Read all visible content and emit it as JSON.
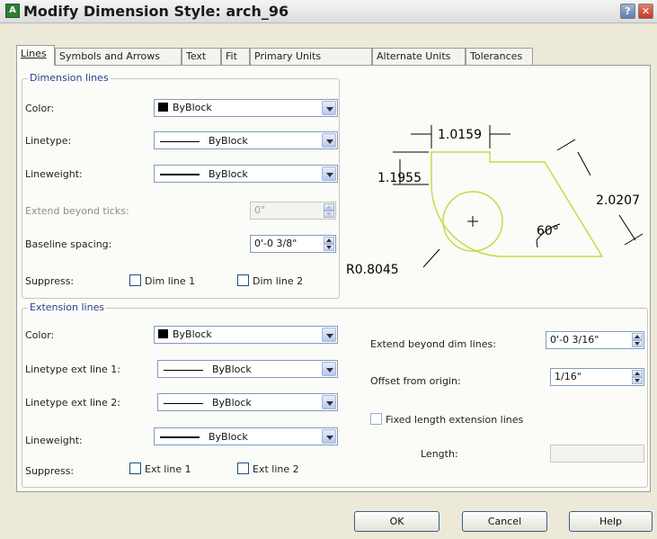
{
  "window": {
    "title": "Modify Dimension Style: arch_96",
    "help_symbol": "?",
    "close_symbol": "✕"
  },
  "tabs": [
    "Lines",
    "Symbols and Arrows",
    "Text",
    "Fit",
    "Primary Units",
    "Alternate Units",
    "Tolerances"
  ],
  "dimension_lines": {
    "group_title": "Dimension lines",
    "color_label": "Color:",
    "color_value": "ByBlock",
    "linetype_label": "Linetype:",
    "linetype_value": "ByBlock",
    "lineweight_label": "Lineweight:",
    "lineweight_value": "ByBlock",
    "extend_label": "Extend beyond ticks:",
    "extend_value": "0\"",
    "baseline_label": "Baseline spacing:",
    "baseline_value": "0'-0 3/8\"",
    "suppress_label": "Suppress:",
    "dim_line_1": "Dim line 1",
    "dim_line_2": "Dim line 2"
  },
  "extension_lines": {
    "group_title": "Extension lines",
    "color_label": "Color:",
    "color_value": "ByBlock",
    "linetype1_label": "Linetype ext line 1:",
    "linetype1_value": "ByBlock",
    "linetype2_label": "Linetype ext line 2:",
    "linetype2_value": "ByBlock",
    "lineweight_label": "Lineweight:",
    "lineweight_value": "ByBlock",
    "suppress_label": "Suppress:",
    "ext_line_1": "Ext line 1",
    "ext_line_2": "Ext line 2",
    "extend_label": "Extend beyond dim lines:",
    "extend_value": "0'-0 3/16\"",
    "offset_label": "Offset from origin:",
    "offset_value": "1/16\"",
    "fixed_label": "Fixed length extension lines",
    "length_label": "Length:",
    "length_value": ""
  },
  "preview": {
    "dim_top": "1.0159",
    "dim_left": "1.1955",
    "dim_right": "2.0207",
    "angle": "60°",
    "radius": "R0.8045",
    "shape_color": "#c9d84a"
  },
  "buttons": {
    "ok": "OK",
    "cancel": "Cancel",
    "help": "Help"
  }
}
